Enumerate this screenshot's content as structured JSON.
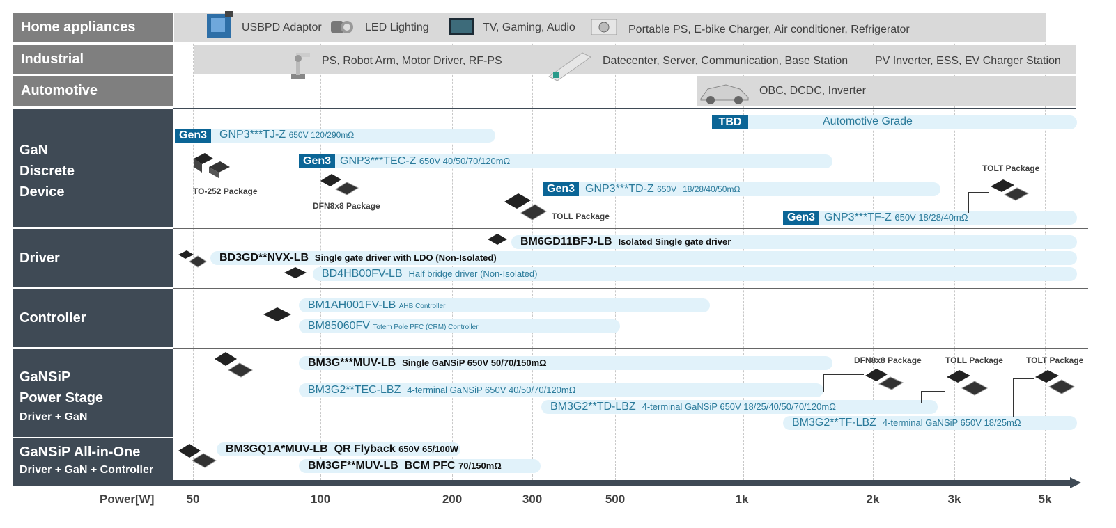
{
  "applications": [
    {
      "label": "Home appliances",
      "items": [
        "USBPD Adaptor",
        "LED Lighting",
        "TV, Gaming, Audio",
        "Portable PS, E-bike Charger, Air conditioner, Refrigerator"
      ]
    },
    {
      "label": "Industrial",
      "items": [
        "PS, Robot Arm, Motor Driver, RF-PS",
        "Datecenter, Server, Communication, Base Station",
        "PV Inverter, ESS, EV Charger Station"
      ]
    },
    {
      "label": "Automotive",
      "items": [
        "OBC, DCDC, Inverter"
      ]
    }
  ],
  "categories": {
    "gan": [
      "GaN",
      "Discrete",
      "Device"
    ],
    "driver": "Driver",
    "controller": "Controller",
    "gansip": [
      "GaNSiP",
      "Power Stage",
      "Driver + GaN"
    ],
    "aio": [
      "GaNSiP All-in-One",
      "Driver + GaN + Controller"
    ]
  },
  "gan": {
    "tbd_tag": "TBD",
    "tbd_text": "Automotive Grade",
    "p1": {
      "tag": "Gen3",
      "name": "GNP3***TJ-Z",
      "spec": "650V 120/290mΩ"
    },
    "p2": {
      "tag": "Gen3",
      "name": "GNP3***TEC-Z",
      "spec": "650V 40/50/70/120mΩ"
    },
    "p3": {
      "tag": "Gen3",
      "name": "GNP3***TD-Z",
      "spec1": "650V",
      "spec2": "18/28/40/50mΩ"
    },
    "p4": {
      "tag": "Gen3",
      "name": "GNP3***TF-Z",
      "spec": "650V 18/28/40mΩ"
    },
    "pkg_to252": "TO-252 Package",
    "pkg_dfn": "DFN8x8 Package",
    "pkg_toll": "TOLL Package",
    "pkg_tolt": "TOLT Package"
  },
  "driver": {
    "d1": {
      "name": "BM6GD11BFJ-LB",
      "desc": "Isolated Single gate driver"
    },
    "d2": {
      "name": "BD3GD**NVX-LB",
      "desc": "Single gate driver with LDO (Non-Isolated)"
    },
    "d3": {
      "name": "BD4HB00FV-LB",
      "desc": "Half bridge driver (Non-Isolated)"
    }
  },
  "controller": {
    "c1": {
      "name": "BM1AH001FV-LB",
      "desc": "AHB Controller"
    },
    "c2": {
      "name": "BM85060FV",
      "desc": "Totem Pole PFC (CRM) Controller"
    }
  },
  "gansip": {
    "s1": {
      "name": "BM3G***MUV-LB",
      "desc": "Single GaNSiP 650V 50/70/150mΩ"
    },
    "s2": {
      "name": "BM3G2**TEC-LBZ",
      "desc": "4-terminal GaNSiP 650V 40/50/70/120mΩ"
    },
    "s3": {
      "name": "BM3G2**TD-LBZ",
      "desc": "4-terminal GaNSiP 650V 18/25/40/50/70/120mΩ"
    },
    "s4": {
      "name": "BM3G2**TF-LBZ",
      "desc": "4-terminal GaNSiP 650V 18/25mΩ"
    },
    "pkg_dfn": "DFN8x8 Package",
    "pkg_toll": "TOLL Package",
    "pkg_tolt": "TOLT Package"
  },
  "aio": {
    "a1": {
      "name": "BM3GQ1A*MUV-LB",
      "desc": "QR Flyback",
      "spec": "650V 65/100W"
    },
    "a2": {
      "name": "BM3GF**MUV-LB",
      "desc": "BCM PFC",
      "spec": "70/150mΩ"
    }
  },
  "axis": {
    "label": "Power[W]",
    "ticks": [
      "50",
      "100",
      "200",
      "300",
      "500",
      "1k",
      "2k",
      "3k",
      "5k"
    ]
  },
  "colors": {
    "accent": "#0b6596",
    "bar": "#e1f2fa",
    "category_bg": "#3f4a55",
    "app_bg": "#7f7f7f",
    "band": "#d9d9d9"
  }
}
